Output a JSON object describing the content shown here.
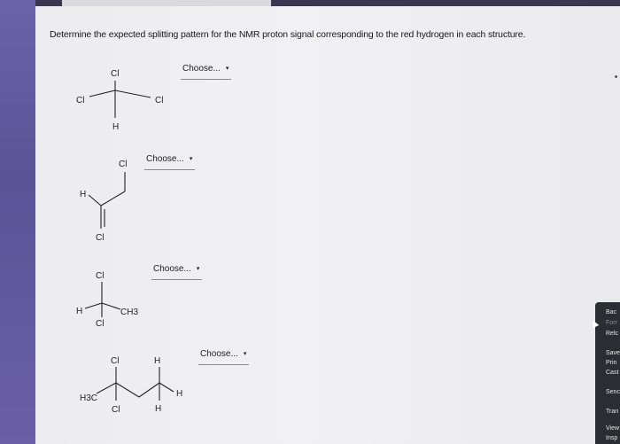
{
  "question": {
    "prompt": "Determine the expected splitting pattern for the NMR proton signal corresponding to the red hydrogen in each structure."
  },
  "structures": [
    {
      "dropdown": {
        "selected": "Choose..."
      },
      "atoms": {
        "top": "Cl",
        "left": "Cl",
        "right": "Cl",
        "bottom": "H"
      }
    },
    {
      "dropdown": {
        "selected": "Choose..."
      },
      "atoms": {
        "top": "Cl",
        "left": "H",
        "bottom": "Cl"
      }
    },
    {
      "dropdown": {
        "selected": "Choose..."
      },
      "atoms": {
        "top": "Cl",
        "left": "H",
        "right": "CH3",
        "bottom": "Cl"
      }
    },
    {
      "dropdown": {
        "selected": "Choose..."
      },
      "atoms": {
        "cl_top": "Cl",
        "h_top": "H",
        "h3c": "H3C",
        "cl_bottom": "Cl",
        "h_right": "H",
        "h_bottom": "H"
      }
    }
  ],
  "side_menu": {
    "items": [
      "Bac",
      "Forr",
      "Relc",
      "Save",
      "Prin",
      "Cast",
      "Senc",
      "Tran",
      "View",
      "Insp"
    ]
  },
  "icons": {
    "caret": "▾"
  },
  "colors": {
    "paper": "#eeeeef",
    "sidebar": "#6a63a8",
    "text": "#1a1a1a"
  }
}
